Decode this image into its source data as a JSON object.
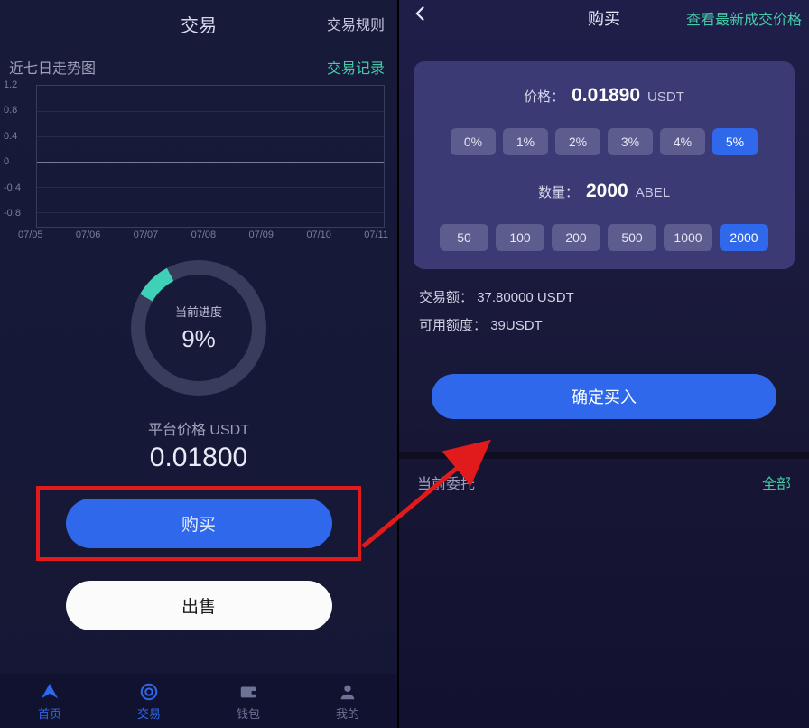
{
  "left": {
    "header_title": "交易",
    "header_right": "交易规则",
    "chart_title": "近七日走势图",
    "chart_link": "交易记录",
    "donut_label": "当前进度",
    "donut_value": "9%",
    "price_label": "平台价格 USDT",
    "price_value": "0.01800",
    "buy_btn": "购买",
    "sell_btn": "出售",
    "nav": [
      {
        "label": "首页"
      },
      {
        "label": "交易"
      },
      {
        "label": "钱包"
      },
      {
        "label": "我的"
      }
    ]
  },
  "right": {
    "header_title": "购买",
    "header_right": "查看最新成交价格",
    "price_label": "价格：",
    "price_value": "0.01890",
    "price_unit": "USDT",
    "pct_options": [
      "0%",
      "1%",
      "2%",
      "3%",
      "4%",
      "5%"
    ],
    "pct_selected": "5%",
    "qty_label": "数量：",
    "qty_value": "2000",
    "qty_unit": "ABEL",
    "qty_options": [
      "50",
      "100",
      "200",
      "500",
      "1000",
      "2000"
    ],
    "qty_selected": "2000",
    "amount_label": "交易额：",
    "amount_value": "37.80000 USDT",
    "avail_label": "可用额度：",
    "avail_value": "39USDT",
    "confirm_btn": "确定买入",
    "orders_title": "当前委托",
    "orders_link": "全部"
  },
  "chart_data": {
    "type": "line",
    "title": "近七日走势图",
    "xlabel": "",
    "ylabel": "",
    "ylim": [
      -1.0,
      1.2
    ],
    "y_ticks": [
      1.2,
      0.8,
      0.4,
      0.0,
      -0.4,
      -0.8
    ],
    "categories": [
      "07/05",
      "07/06",
      "07/07",
      "07/08",
      "07/09",
      "07/10",
      "07/11"
    ],
    "values": [
      0.0,
      0.0,
      0.0,
      0.0,
      0.0,
      0.0,
      0.0
    ]
  }
}
